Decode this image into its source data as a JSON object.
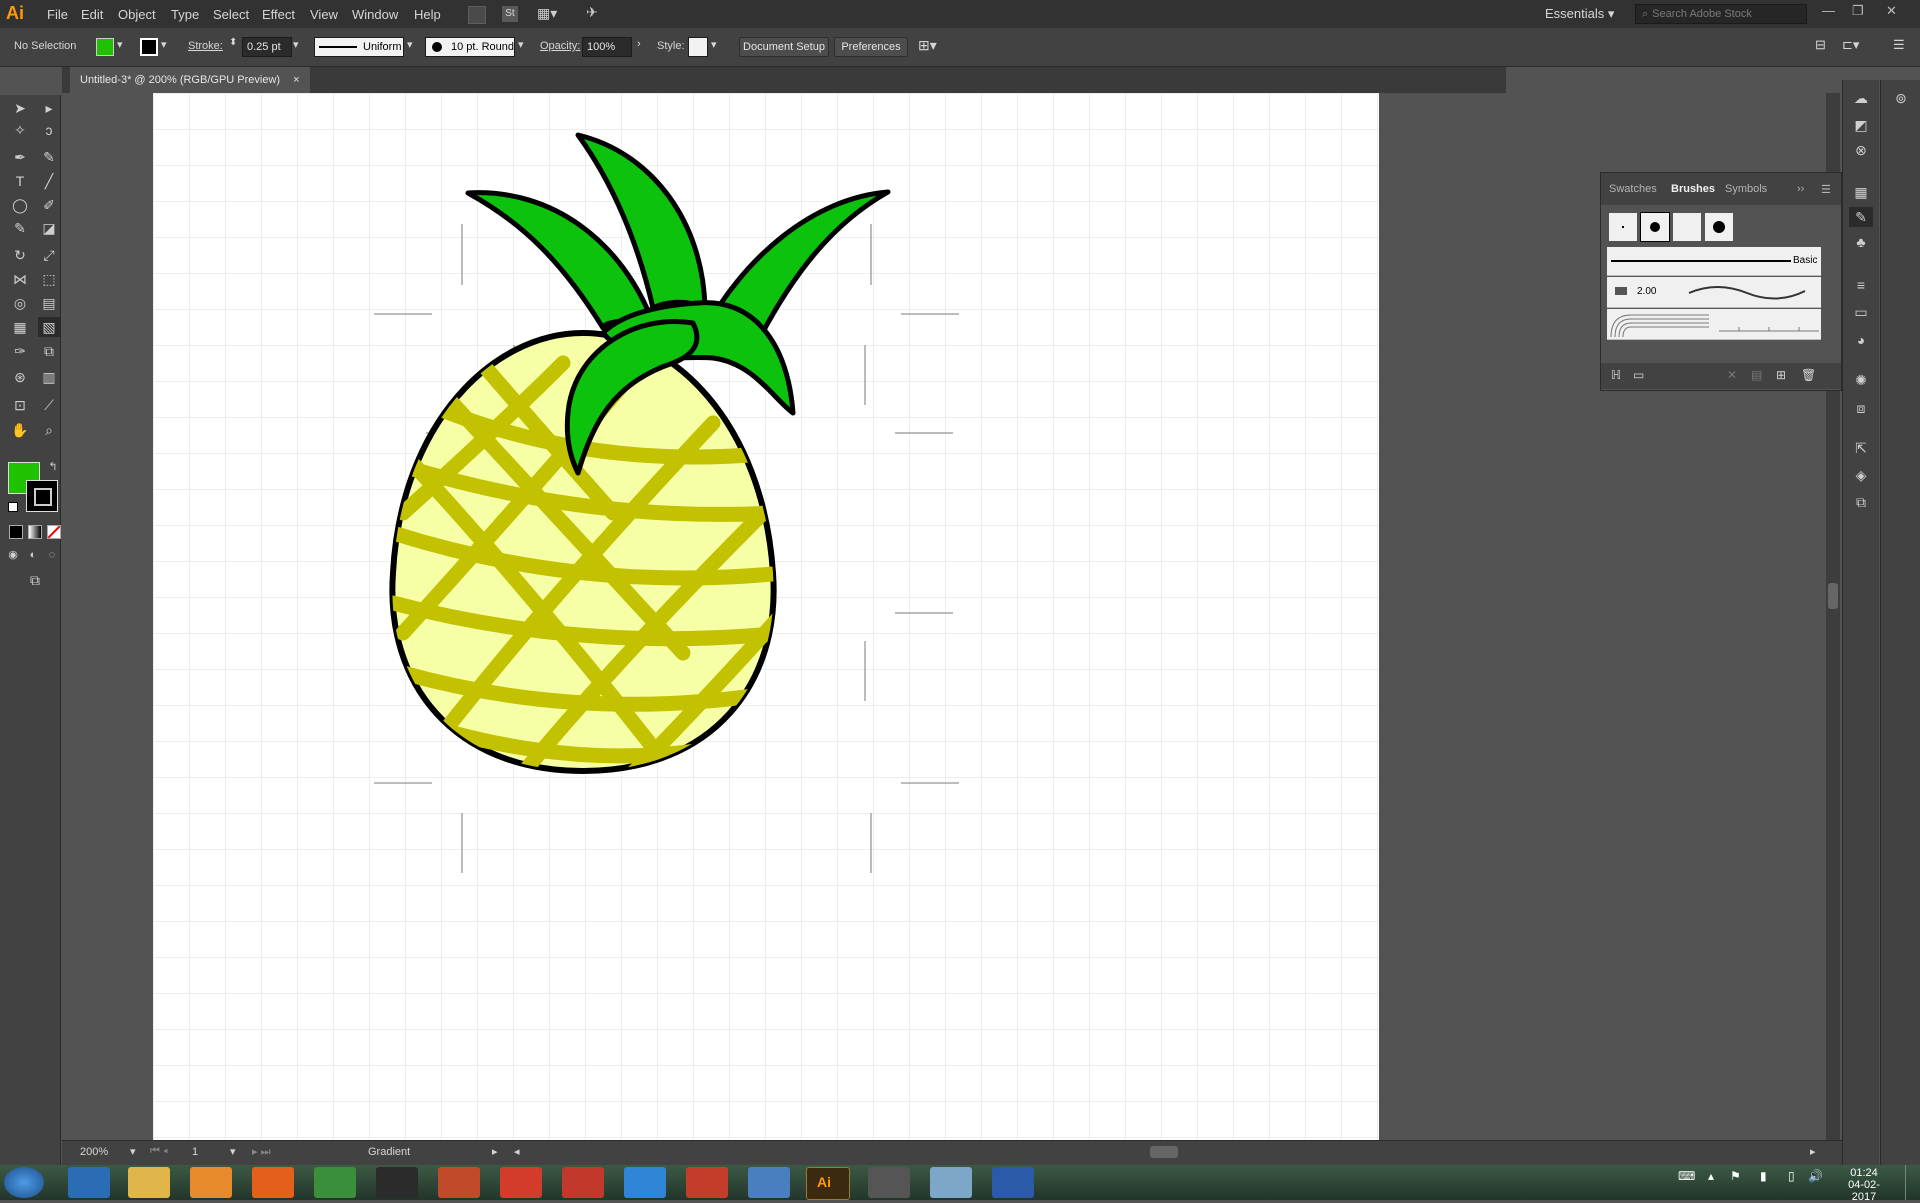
{
  "app": {
    "logo": "Ai"
  },
  "menu": [
    "File",
    "Edit",
    "Object",
    "Type",
    "Select",
    "Effect",
    "View",
    "Window",
    "Help"
  ],
  "workspace": "Essentials",
  "search_placeholder": "Search Adobe Stock",
  "control": {
    "selection": "No Selection",
    "fill_color": "#1fc100",
    "stroke_label": "Stroke:",
    "stroke_weight": "0.25 pt",
    "stroke_profile": "Uniform",
    "brush": "10 pt. Round",
    "opacity_label": "Opacity:",
    "opacity": "100%",
    "style_label": "Style:",
    "doc_setup": "Document Setup",
    "preferences": "Preferences"
  },
  "doc_tab": {
    "title": "Untitled-3* @ 200% (RGB/GPU Preview)",
    "close": "×"
  },
  "brushes_panel": {
    "tabs": [
      "Swatches",
      "Brushes",
      "Symbols"
    ],
    "basic_label": "Basic",
    "brush_size": "2.00"
  },
  "status": {
    "zoom": "200%",
    "artboard": "1",
    "tool": "Gradient"
  },
  "clock": {
    "time": "01:24",
    "date": "04-02-2017"
  },
  "colors": {
    "leaf": "#0cc20c",
    "body": "#f7ffa6",
    "pattern": "#c2c200",
    "outline": "#000000"
  }
}
